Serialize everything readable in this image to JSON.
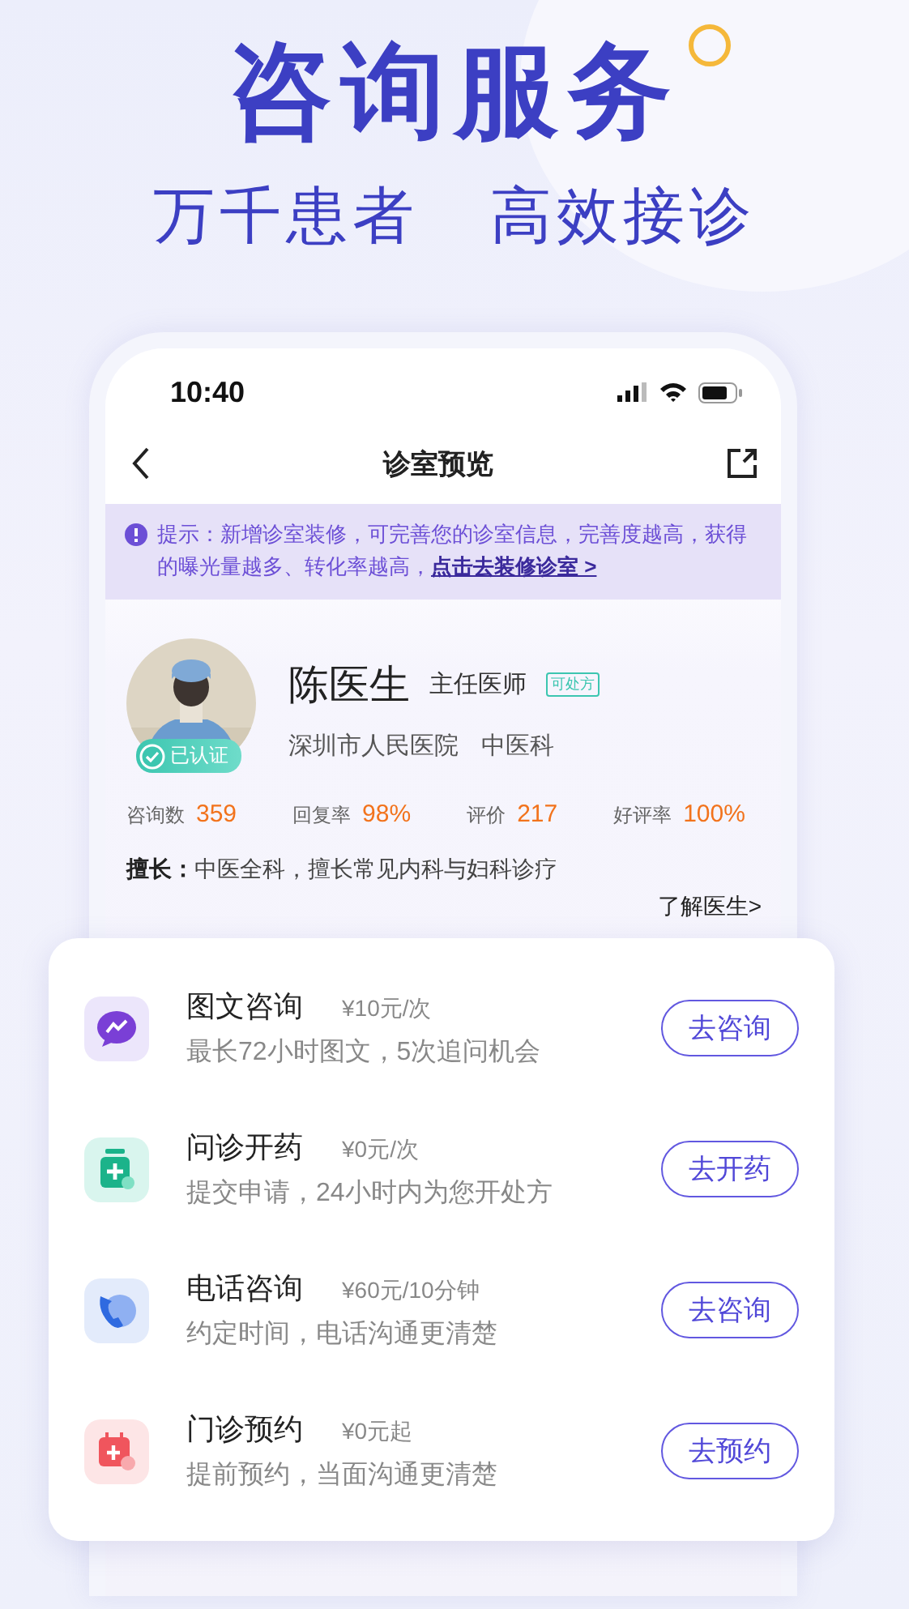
{
  "headline": "咨询服务",
  "subtitle": [
    "万千患者",
    "高效接诊"
  ],
  "status_bar": {
    "time": "10:40"
  },
  "nav": {
    "title": "诊室预览"
  },
  "tip": {
    "label": "提示：",
    "text": "新增诊室装修，可完善您的诊室信息，完善度越高，获得的曝光量越多、转化率越高，",
    "link": "点击去装修诊室 >"
  },
  "doctor": {
    "verified": "已认证",
    "name": "陈医生",
    "title": "主任医师",
    "tag": "可处方",
    "hospital": "深圳市人民医院",
    "department": "中医科",
    "stats": [
      {
        "label": "咨询数",
        "value": "359"
      },
      {
        "label": "回复率",
        "value": "98%"
      },
      {
        "label": "评价",
        "value": "217"
      },
      {
        "label": "好评率",
        "value": "100%"
      }
    ],
    "specialty_label": "擅长：",
    "specialty": "中医全科，擅长常见内科与妇科诊疗",
    "more": "了解医生>"
  },
  "services": [
    {
      "kind": "chat",
      "name": "图文咨询",
      "price": "¥10元/次",
      "desc": "最长72小时图文，5次追问机会",
      "button": "去咨询"
    },
    {
      "kind": "medicine",
      "name": "问诊开药",
      "price": "¥0元/次",
      "desc": "提交申请，24小时内为您开处方",
      "button": "去开药"
    },
    {
      "kind": "phone",
      "name": "电话咨询",
      "price": "¥60元/10分钟",
      "desc": "约定时间，电话沟通更清楚",
      "button": "去咨询"
    },
    {
      "kind": "calendar",
      "name": "门诊预约",
      "price": "¥0元起",
      "desc": "提前预约，当面沟通更清楚",
      "button": "去预约"
    }
  ]
}
